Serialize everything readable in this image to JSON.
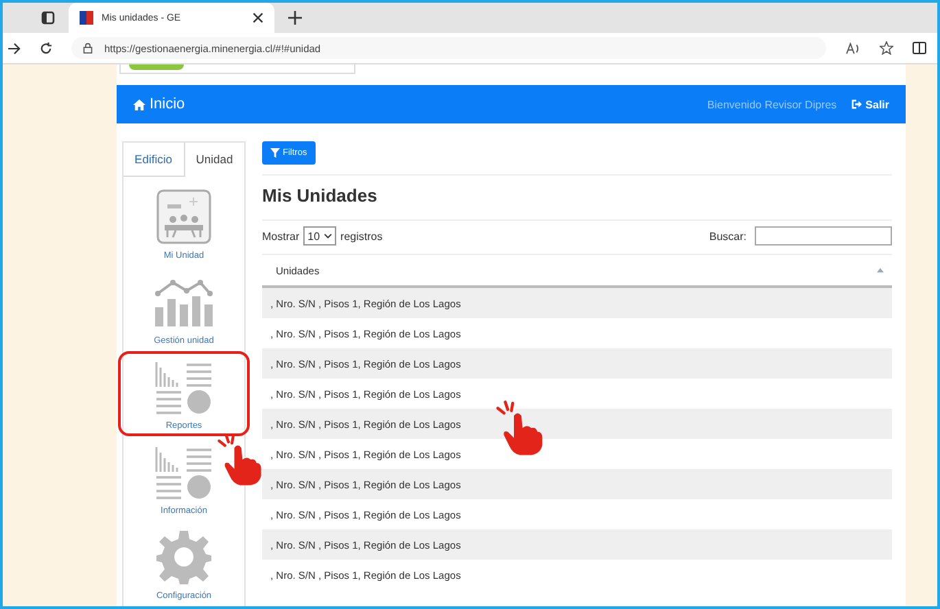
{
  "browser": {
    "tabs": [
      {
        "title": "Mis unidades - GE",
        "selected": true
      }
    ],
    "url": "https://gestionaenergia.minenergia.cl/#!#unidad"
  },
  "header": {
    "home_label": "Inicio",
    "welcome": "Bienvenido Revisor Dipres",
    "logout": "Salir"
  },
  "sidebar": {
    "tabs": [
      {
        "label": "Edificio",
        "selected": false
      },
      {
        "label": "Unidad",
        "selected": true
      }
    ],
    "items": [
      {
        "label": "Mi Unidad",
        "kind": "photo",
        "highlighted": false,
        "pointer": false
      },
      {
        "label": "Gestión unidad",
        "kind": "chart",
        "highlighted": false,
        "pointer": false
      },
      {
        "label": "Reportes",
        "kind": "report",
        "highlighted": true,
        "pointer": false
      },
      {
        "label": "Información",
        "kind": "report",
        "highlighted": false,
        "pointer": true
      },
      {
        "label": "Configuración",
        "kind": "gear",
        "highlighted": false,
        "pointer": false
      }
    ]
  },
  "content": {
    "filter_button": "Filtros",
    "title": "Mis Unidades",
    "show_label": "Mostrar",
    "page_size": "10",
    "records_label": "registros",
    "search_label": "Buscar:",
    "table": {
      "columns": [
        "Unidades"
      ],
      "rows": [
        {
          "cells": [
            ", Nro. S/N , Pisos 1, Región de Los Lagos"
          ],
          "pointer": false
        },
        {
          "cells": [
            ", Nro. S/N , Pisos 1, Región de Los Lagos"
          ],
          "pointer": false
        },
        {
          "cells": [
            ", Nro. S/N , Pisos 1, Región de Los Lagos"
          ],
          "pointer": false
        },
        {
          "cells": [
            ", Nro. S/N , Pisos 1, Región de Los Lagos"
          ],
          "pointer": false
        },
        {
          "cells": [
            ", Nro. S/N , Pisos 1, Región de Los Lagos"
          ],
          "pointer": true
        },
        {
          "cells": [
            ", Nro. S/N , Pisos 1, Región de Los Lagos"
          ],
          "pointer": false
        },
        {
          "cells": [
            ", Nro. S/N , Pisos 1, Región de Los Lagos"
          ],
          "pointer": false
        },
        {
          "cells": [
            ", Nro. S/N , Pisos 1, Región de Los Lagos"
          ],
          "pointer": false
        },
        {
          "cells": [
            ", Nro. S/N , Pisos 1, Región de Los Lagos"
          ],
          "pointer": false
        },
        {
          "cells": [
            ", Nro. S/N , Pisos 1, Región de Los Lagos"
          ],
          "pointer": false
        }
      ]
    }
  }
}
